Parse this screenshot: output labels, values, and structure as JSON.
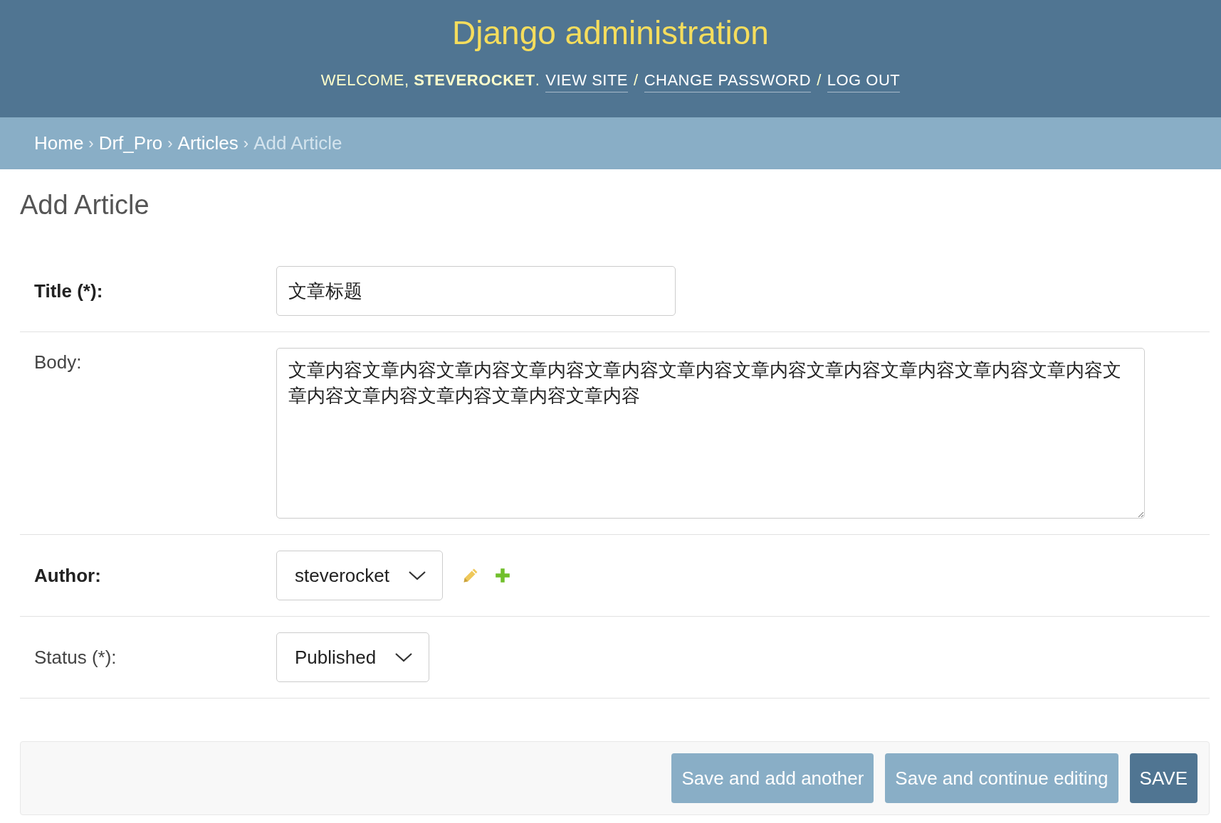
{
  "header": {
    "title": "Django administration",
    "welcome": "WELCOME, **STEVEROCKET**.",
    "separator": "/",
    "links": [
      {
        "label": "VIEW SITE"
      },
      {
        "label": "CHANGE PASSWORD"
      },
      {
        "label": "LOG OUT"
      }
    ]
  },
  "breadcrumbs": {
    "separator": "›",
    "items": [
      {
        "label": "Home",
        "current": false
      },
      {
        "label": "Drf_Pro",
        "current": false
      },
      {
        "label": "Articles",
        "current": false
      },
      {
        "label": "Add Article",
        "current": true
      }
    ]
  },
  "heading": "Add Article",
  "fields": [
    {
      "kind": "text",
      "label": "Title (*):",
      "bold": true,
      "value": "文章标题"
    },
    {
      "kind": "textarea",
      "label": "Body:",
      "bold": false,
      "value": "文章内容文章内容文章内容文章内容文章内容文章内容文章内容文章内容文章内容文章内容文章内容文章内容文章内容文章内容文章内容文章内容"
    },
    {
      "kind": "select",
      "label": "Author:",
      "bold": true,
      "value": "steverocket",
      "related_actions": true
    },
    {
      "kind": "select",
      "label": "Status (*):",
      "bold": false,
      "value": "Published",
      "related_actions": false
    }
  ],
  "buttons": [
    {
      "label": "Save and add another",
      "kind": "secondary"
    },
    {
      "label": "Save and continue editing",
      "kind": "secondary"
    },
    {
      "label": "SAVE",
      "kind": "primary"
    }
  ]
}
